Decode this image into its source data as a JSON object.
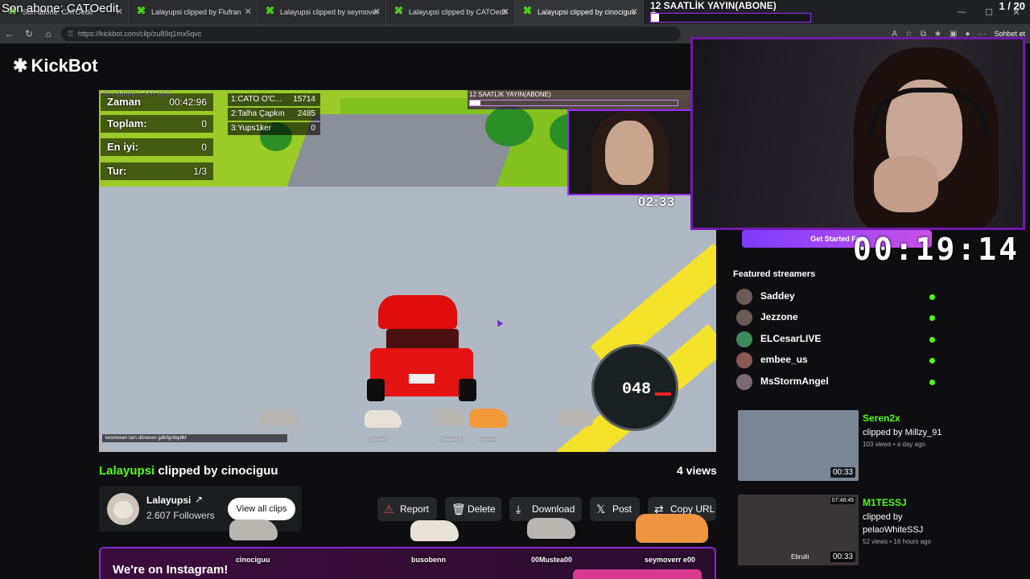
{
  "browser": {
    "tabs": [
      {
        "label": "Son abone: CATOedit"
      },
      {
        "label": "Lalayupsi clipped by Flufran"
      },
      {
        "label": "Lalayupsi clipped by seymoverr"
      },
      {
        "label": "Lalayupsi clipped by CATOedit"
      },
      {
        "label": "Lalayupsi clipped by cinociguu"
      }
    ],
    "new_tab": "+",
    "url": "https://kickbot.com/clip/zu89q1mx5qvc",
    "chat_button": "Sohbet et"
  },
  "stream_overlay": {
    "subscriber": "Son abone: CATOedit",
    "goal_text": "12 SAATLİK YAYIN(ABONE)",
    "goal_progress": 0.05,
    "pager": "1 / 20",
    "timer": "00:19:14",
    "get_started": "Get Started For"
  },
  "site": {
    "logo": "KickBot"
  },
  "video": {
    "subscriber": "Son abone: CATOedit",
    "hud": [
      {
        "label": "Zaman",
        "value": "00:42:96"
      },
      {
        "label": "Toplam:",
        "value": "0"
      },
      {
        "label": "En iyi:",
        "value": "0"
      },
      {
        "label": "Tur:",
        "value": "1/3"
      }
    ],
    "leaderboard": [
      {
        "name": "1:CATO O'C...",
        "score": "15714"
      },
      {
        "name": "2:Talha Çapkın",
        "score": "2485"
      },
      {
        "name": "3:Yups1ker",
        "score": "0"
      }
    ],
    "goal_text": "12 SAATLİK YAYIN(ABONE)",
    "goal_progress": 0.05,
    "timer": "02:33",
    "speed": "048",
    "chat": "kesmesen tam dönecen gdkifgnbqdlkf",
    "cat_names": [
      "busobenn",
      "00Mustea00",
      "seymoverr"
    ]
  },
  "clip": {
    "user": "Lalayupsi",
    "clipped_by": "clipped by cinociguu",
    "views": "4 views",
    "streamer": "Lalayupsi",
    "followers": "2.607 Followers",
    "view_all": "View all clips",
    "actions": {
      "report": "Report",
      "delete": "Delete",
      "download": "Download",
      "post": "Post",
      "copy": "Copy URL"
    }
  },
  "banner": {
    "text": "We're on Instagram!"
  },
  "cats": [
    {
      "name": "cinociguu"
    },
    {
      "name": "busobenn"
    },
    {
      "name": "00Mustea00"
    },
    {
      "name": "seymoverr e00"
    }
  ],
  "featured": {
    "title": "Featured streamers",
    "streamers": [
      {
        "name": "Saddey"
      },
      {
        "name": "Jezzone"
      },
      {
        "name": "ELCesarLIVE"
      },
      {
        "name": "embee_us"
      },
      {
        "name": "MsStormAngel"
      }
    ]
  },
  "related": [
    {
      "game": "Seren2x",
      "by": "clipped by Millzy_91",
      "meta": "103 views • a day ago",
      "duration": "00:33"
    },
    {
      "game": "M1TESSJ",
      "by": "clipped by pelaoWhiteSSJ",
      "meta": "52 views • 16 hours ago",
      "duration": "00:33",
      "corner": "07:48:45",
      "caption": "Ebrulii"
    }
  ]
}
